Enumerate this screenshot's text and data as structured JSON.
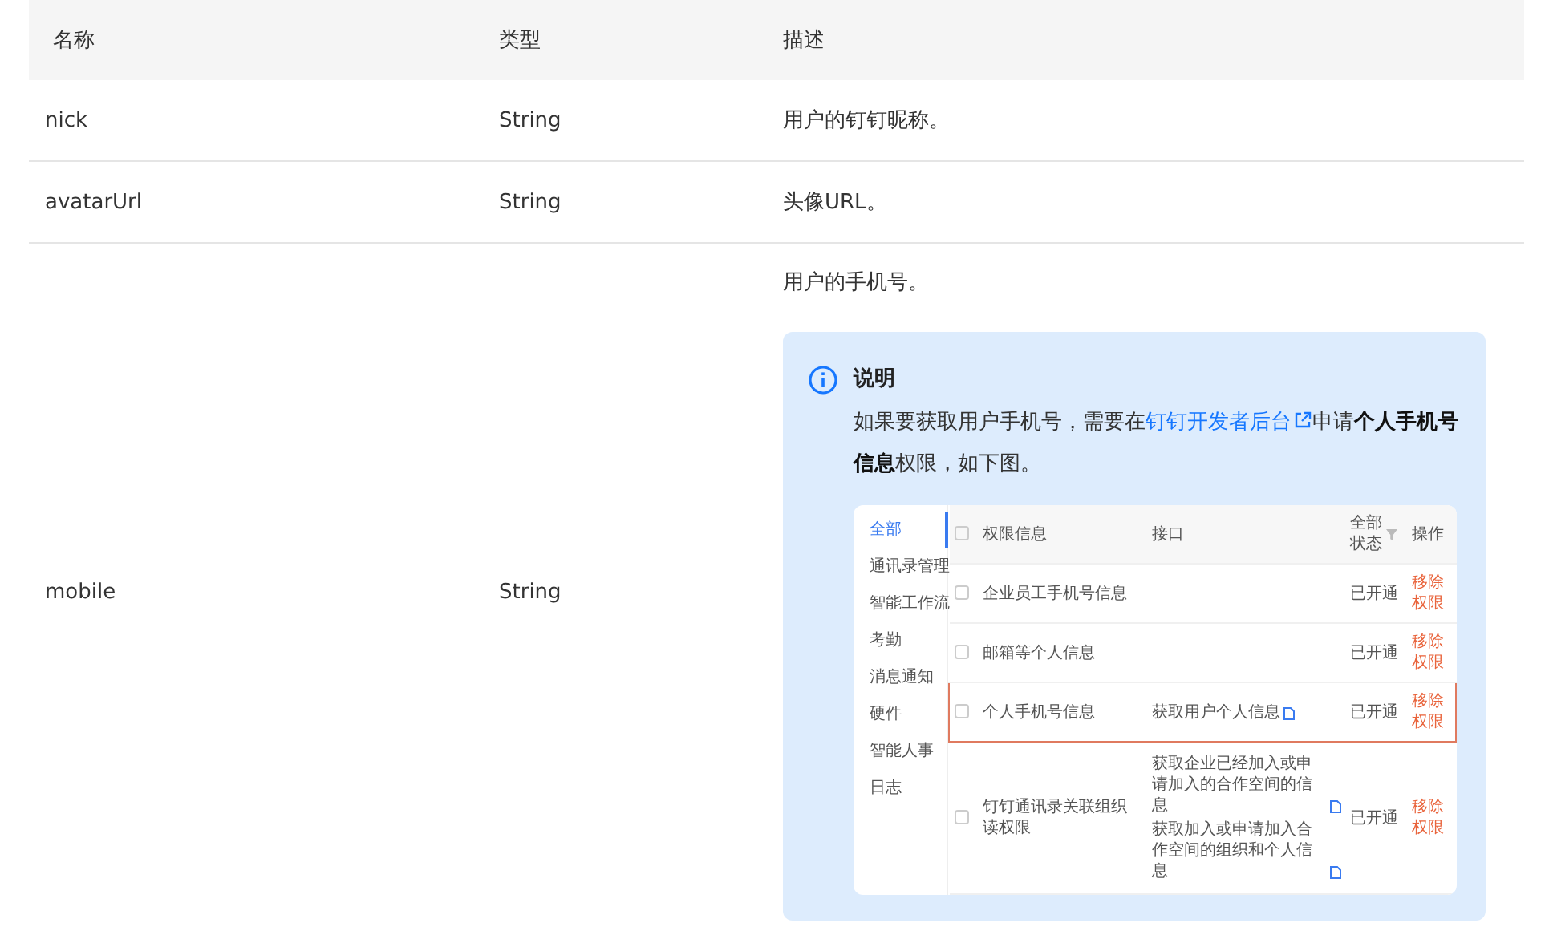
{
  "table": {
    "columns": [
      "名称",
      "类型",
      "描述"
    ],
    "rows": [
      {
        "name": "nick",
        "type": "String",
        "description": "用户的钉钉昵称。"
      },
      {
        "name": "avatarUrl",
        "type": "String",
        "description": "头像URL。"
      },
      {
        "name": "mobile",
        "type": "String",
        "description": "用户的手机号。",
        "note": {
          "title": "说明",
          "text_before": "如果要获取用户手机号，需要在",
          "link": "钉钉开发者后台",
          "text_after": "申请**个人手机号信息**权限，如下图。",
          "screenshot": {
            "sidebar": [
              {
                "label": "全部",
                "selected": true
              },
              {
                "label": "通讯录管理",
                "selected": false
              },
              {
                "label": "智能工作流",
                "selected": false
              },
              {
                "label": "考勤",
                "selected": false
              },
              {
                "label": "消息通知",
                "selected": false
              },
              {
                "label": "硬件",
                "selected": false
              },
              {
                "label": "智能人事",
                "selected": false
              },
              {
                "label": "日志",
                "selected": false
              }
            ],
            "header_checked": false,
            "columns": [
              "权限信息",
              "接口",
              "全部状态",
              "操作"
            ],
            "rows": [
              {
                "permission": "企业员工手机号信息",
                "apis": [],
                "status": "已开通",
                "action": "移除权限",
                "checked": false,
                "highlighted": false
              },
              {
                "permission": "邮箱等个人信息",
                "apis": [],
                "status": "已开通",
                "action": "移除权限",
                "checked": false,
                "highlighted": false
              },
              {
                "permission": "个人手机号信息",
                "apis": [
                  "获取用户个人信息"
                ],
                "status": "已开通",
                "action": "移除权限",
                "checked": false,
                "highlighted": true
              },
              {
                "permission": "钉钉通讯录关联组织读权限",
                "apis": [
                  "获取企业已经加入或申请加入的合作空间的信息",
                  "获取加入或申请加入合作空间的组织和个人信息"
                ],
                "status": "已开通",
                "action": "移除权限",
                "checked": false,
                "highlighted": false
              }
            ]
          }
        }
      }
    ]
  }
}
